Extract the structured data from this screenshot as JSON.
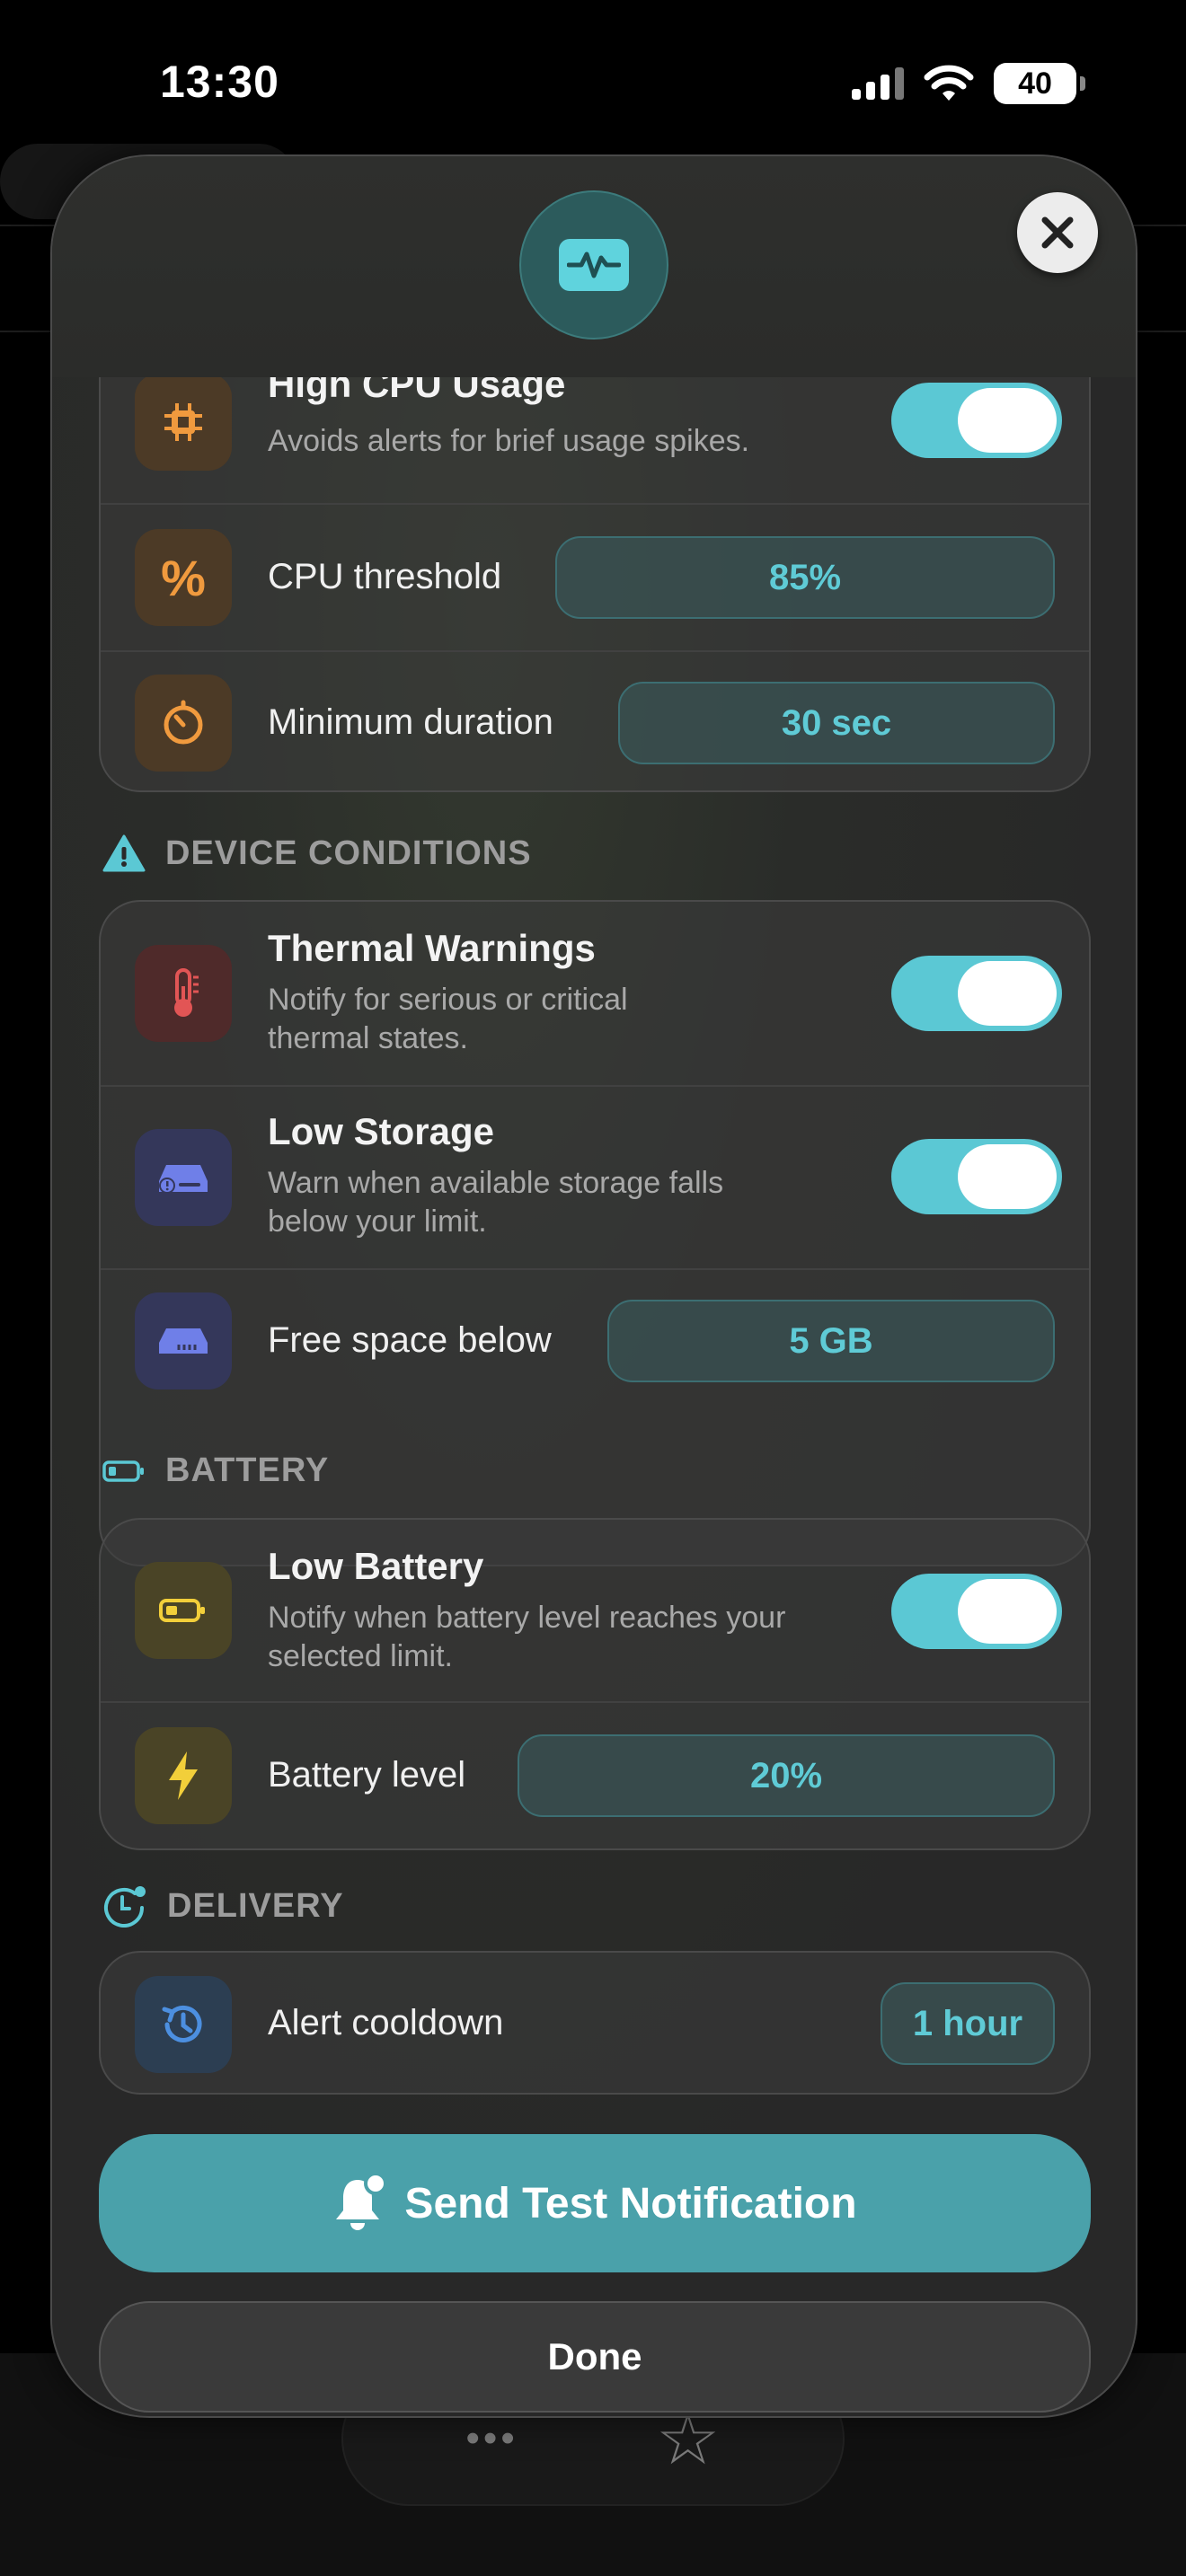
{
  "status": {
    "time": "13:30",
    "battery": "40"
  },
  "background": {
    "tab_more": "•••",
    "tab_star": "☆"
  },
  "alerts": {
    "high_cpu": {
      "title": "High CPU Usage",
      "subtitle": "Avoids alerts for brief usage spikes.",
      "enabled": true
    },
    "cpu_threshold": {
      "label": "CPU threshold",
      "value": "85%"
    },
    "min_duration": {
      "label": "Minimum duration",
      "value": "30 sec"
    }
  },
  "device_conditions": {
    "heading": "DEVICE CONDITIONS",
    "thermal": {
      "title": "Thermal Warnings",
      "subtitle_1": "Notify for serious or critical",
      "subtitle_2": "thermal states.",
      "enabled": true
    },
    "low_storage": {
      "title": "Low Storage",
      "subtitle_1": "Warn when available storage falls",
      "subtitle_2": "below your limit.",
      "enabled": true
    },
    "free_space": {
      "label": "Free space below",
      "value": "5 GB"
    }
  },
  "battery": {
    "heading": "BATTERY",
    "low_battery": {
      "title": "Low Battery",
      "subtitle_1": "Notify when battery level reaches your",
      "subtitle_2": "selected limit.",
      "enabled": true
    },
    "battery_level": {
      "label": "Battery level",
      "value": "20%"
    }
  },
  "delivery": {
    "heading": "DELIVERY",
    "cooldown": {
      "label": "Alert cooldown",
      "value": "1 hour"
    }
  },
  "actions": {
    "send_test": "Send Test Notification",
    "done": "Done"
  },
  "colors": {
    "accent": "#5bc8d4",
    "primary_button": "#4aa1aa",
    "cpu_orange": "#f09a3e",
    "thermal_red": "#e25555",
    "storage_blue": "#6f7fe8",
    "battery_yellow": "#f2cf3a",
    "history_blue": "#4c8fe0"
  }
}
